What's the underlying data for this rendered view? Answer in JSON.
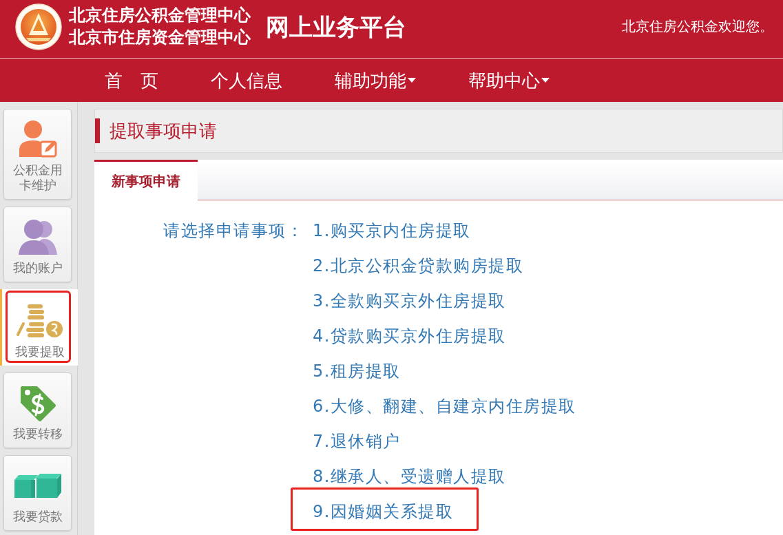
{
  "header": {
    "org_names": [
      "北京住房公积金管理中心",
      "北京市住房资金管理中心"
    ],
    "platform_title": "网上业务平台",
    "welcome": "北京住房公积金欢迎您。"
  },
  "nav": {
    "items": [
      {
        "label": "首　页",
        "dropdown": false
      },
      {
        "label": "个人信息",
        "dropdown": false
      },
      {
        "label": "辅助功能",
        "dropdown": true
      },
      {
        "label": "帮助中心",
        "dropdown": true
      }
    ]
  },
  "sidebar": {
    "items": [
      {
        "label": "公积金用卡维护",
        "kind": "card",
        "selected": false,
        "highlighted": false
      },
      {
        "label": "我的账户",
        "kind": "account",
        "selected": false,
        "highlighted": false
      },
      {
        "label": "我要提取",
        "kind": "withdraw",
        "selected": true,
        "highlighted": true
      },
      {
        "label": "我要转移",
        "kind": "transfer",
        "selected": false,
        "highlighted": false
      },
      {
        "label": "我要贷款",
        "kind": "loan",
        "selected": false,
        "highlighted": false
      }
    ]
  },
  "page_title": "提取事项申请",
  "tabs": [
    {
      "label": "新事项申请",
      "selected": true
    }
  ],
  "application": {
    "prompt": "请选择申请事项：",
    "options": [
      {
        "label": "1.购买京内住房提取",
        "highlighted": false
      },
      {
        "label": "2.北京公积金贷款购房提取",
        "highlighted": false
      },
      {
        "label": "3.全款购买京外住房提取",
        "highlighted": false
      },
      {
        "label": "4.贷款购买京外住房提取",
        "highlighted": false
      },
      {
        "label": "5.租房提取",
        "highlighted": false
      },
      {
        "label": "6.大修、翻建、自建京内住房提取",
        "highlighted": false
      },
      {
        "label": "7.退休销户",
        "highlighted": false
      },
      {
        "label": "8.继承人、受遗赠人提取",
        "highlighted": false
      },
      {
        "label": "9.因婚姻关系提取",
        "highlighted": true
      }
    ]
  }
}
